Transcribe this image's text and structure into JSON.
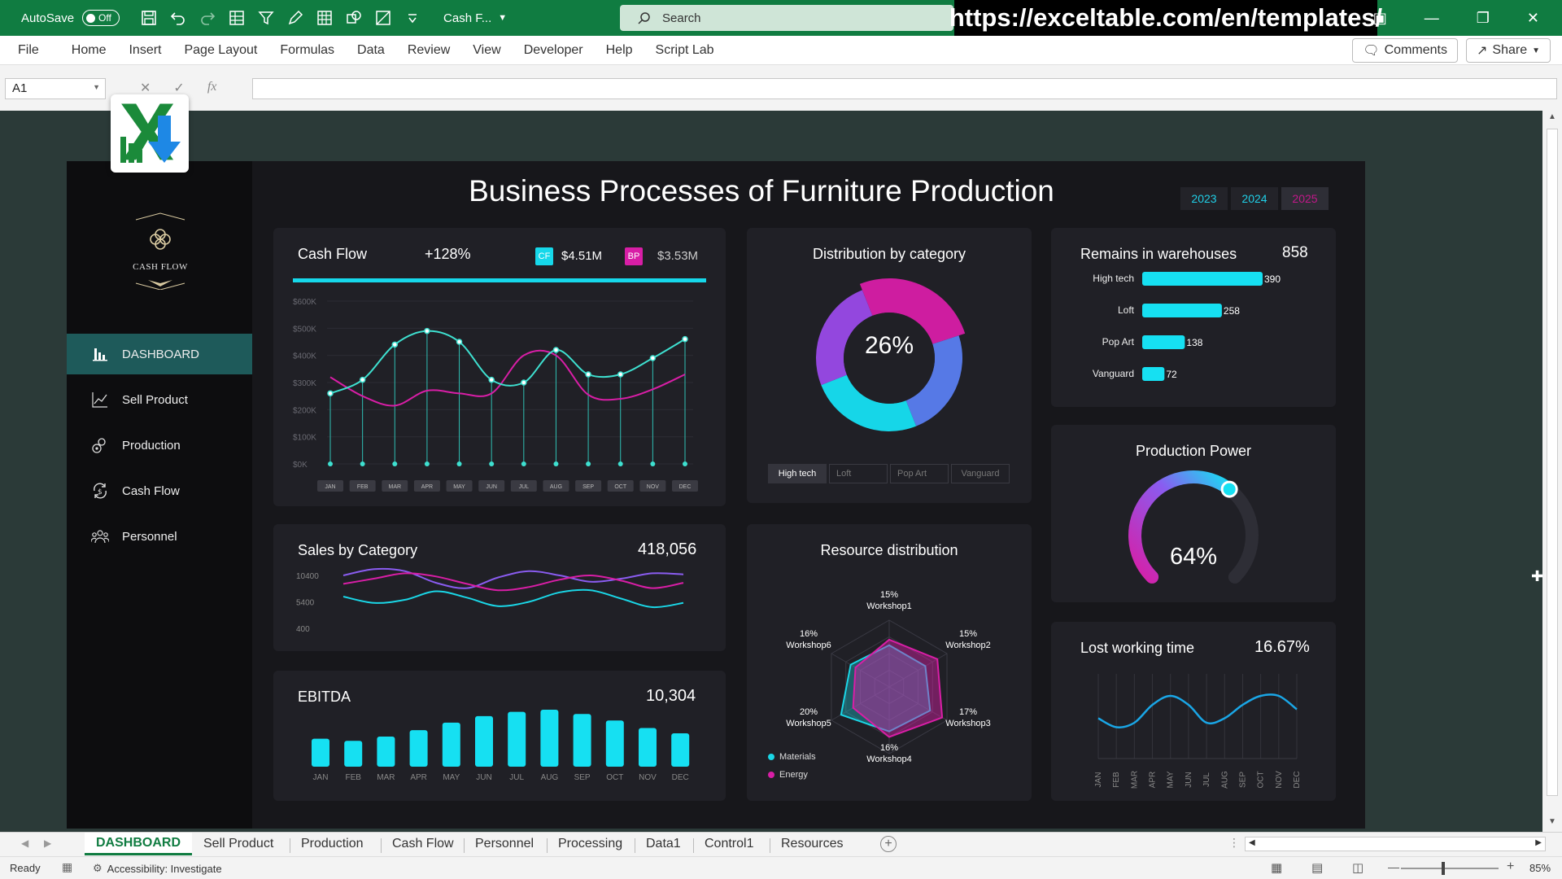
{
  "titlebar": {
    "autosave_label": "AutoSave",
    "toggle_state": "Off",
    "doc_name": "Cash F...",
    "search_placeholder": "Search",
    "url_banner": "https://exceltable.com/en/templates/"
  },
  "menu": {
    "items": [
      "File",
      "Home",
      "Insert",
      "Page Layout",
      "Formulas",
      "Data",
      "Review",
      "View",
      "Developer",
      "Help",
      "Script Lab"
    ],
    "comments_label": "Comments",
    "share_label": "Share"
  },
  "formula_bar": {
    "cell_ref": "A1",
    "fx": "fx"
  },
  "dashboard": {
    "title": "Business Processes of Furniture Production",
    "brand_label": "CASH FLOW",
    "years": [
      "2023",
      "2024",
      "2025"
    ],
    "selected_year": "2025",
    "nav": [
      "DASHBOARD",
      "Sell Product",
      "Production",
      "Cash Flow",
      "Personnel"
    ],
    "colors": {
      "cyan": "#16e0f2",
      "magenta": "#d81ea6",
      "purple": "#8a5cf0",
      "bg": "#17171b",
      "card": "#202026"
    }
  },
  "cash_flow": {
    "title": "Cash Flow",
    "change": "+128%",
    "cf_badge": "CF",
    "cf_value": "$4.51M",
    "bp_badge": "BP",
    "bp_value": "$3.53M"
  },
  "distribution": {
    "title": "Distribution by category",
    "center_value": "26%",
    "buttons": [
      "High tech",
      "Loft",
      "Pop Art",
      "Vanguard"
    ]
  },
  "warehouses": {
    "title": "Remains in warehouses",
    "total": "858"
  },
  "sales": {
    "title": "Sales by Category",
    "total": "418,056"
  },
  "resource": {
    "title": "Resource distribution",
    "legend": [
      "Materials",
      "Energy"
    ]
  },
  "production_power": {
    "title": "Production Power",
    "value": "64%",
    "level": 0.64
  },
  "ebitda": {
    "title": "EBITDA",
    "total": "10,304"
  },
  "lost_time": {
    "title": "Lost working time",
    "value": "16.67%"
  },
  "chart_data": [
    {
      "type": "line",
      "name": "cash-flow",
      "categories": [
        "JAN",
        "FEB",
        "MAR",
        "APR",
        "MAY",
        "JUN",
        "JUL",
        "AUG",
        "SEP",
        "OCT",
        "NOV",
        "DEC"
      ],
      "y_tick_labels": [
        "$0K",
        "$100K",
        "$200K",
        "$300K",
        "$400K",
        "$500K",
        "$600K"
      ],
      "ylim": [
        0,
        600
      ],
      "grid": true,
      "series": [
        {
          "name": "CF",
          "color": "#3ee0d0",
          "values": [
            260,
            310,
            440,
            490,
            450,
            310,
            300,
            420,
            330,
            330,
            390,
            460
          ]
        },
        {
          "name": "BP",
          "color": "#d81ea6",
          "values": [
            320,
            250,
            215,
            270,
            260,
            260,
            400,
            400,
            255,
            240,
            275,
            330
          ]
        }
      ]
    },
    {
      "type": "pie",
      "name": "distribution-by-category",
      "categories": [
        "High tech",
        "Loft",
        "Pop Art",
        "Vanguard"
      ],
      "values": [
        26,
        24,
        25,
        25
      ]
    },
    {
      "type": "bar",
      "name": "remains-in-warehouses",
      "categories": [
        "High tech",
        "Loft",
        "Pop Art",
        "Vanguard"
      ],
      "values": [
        390,
        258,
        138,
        72
      ],
      "value_labels": [
        "390",
        "258",
        "138",
        "72"
      ]
    },
    {
      "type": "line",
      "name": "sales-by-category",
      "y_tick_labels": [
        "10400",
        "5400",
        "400"
      ],
      "ylim": [
        400,
        12400
      ],
      "x": [
        0,
        1,
        2,
        3,
        4,
        5,
        6,
        7,
        8,
        9,
        10,
        11
      ],
      "series": [
        {
          "color": "#8a5cf0",
          "values": [
            10400,
            11600,
            11200,
            9000,
            8000,
            10000,
            11200,
            10400,
            9200,
            9800,
            10800,
            10600
          ]
        },
        {
          "color": "#d81ea6",
          "values": [
            8800,
            9800,
            10800,
            10200,
            8800,
            7600,
            8200,
            9600,
            10400,
            9400,
            8000,
            9000
          ]
        },
        {
          "color": "#1ad6e6",
          "values": [
            6400,
            5200,
            5800,
            7400,
            6200,
            4600,
            5400,
            7200,
            7600,
            6000,
            4400,
            5200
          ]
        }
      ]
    },
    {
      "type": "radar",
      "name": "resource-distribution",
      "categories": [
        "Workshop1",
        "Workshop2",
        "Workshop3",
        "Workshop4",
        "Workshop5",
        "Workshop6"
      ],
      "category_labels": [
        "15%",
        "15%",
        "17%",
        "16%",
        "20%",
        "16%"
      ],
      "series": [
        {
          "name": "Materials",
          "color": "#1ad6e6",
          "values": [
            15,
            15,
            17,
            16,
            20,
            16
          ]
        },
        {
          "name": "Energy",
          "color": "#d81ea6",
          "values": [
            17,
            20,
            22,
            18,
            15,
            14
          ]
        }
      ]
    },
    {
      "type": "bar",
      "name": "ebitda",
      "categories": [
        "JAN",
        "FEB",
        "MAR",
        "APR",
        "MAY",
        "JUN",
        "JUL",
        "AUG",
        "SEP",
        "OCT",
        "NOV",
        "DEC"
      ],
      "values": [
        520,
        480,
        560,
        680,
        820,
        940,
        1020,
        1060,
        980,
        860,
        720,
        620
      ]
    },
    {
      "type": "line",
      "name": "lost-working-time",
      "categories": [
        "JAN",
        "FEB",
        "MAR",
        "APR",
        "MAY",
        "JUN",
        "JUL",
        "AUG",
        "SEP",
        "OCT",
        "NOV",
        "DEC"
      ],
      "series": [
        {
          "color": "#1aa6e6",
          "values": [
            14,
            12,
            13,
            17,
            19,
            17,
            13,
            14,
            17,
            19,
            19,
            16
          ]
        }
      ]
    }
  ],
  "sheet_tabs": [
    "DASHBOARD",
    "Sell Product",
    "Production",
    "Cash Flow",
    "Personnel",
    "Processing",
    "Data1",
    "Control1",
    "Resources"
  ],
  "status": {
    "ready": "Ready",
    "accessibility": "Accessibility: Investigate",
    "zoom": "85%"
  }
}
